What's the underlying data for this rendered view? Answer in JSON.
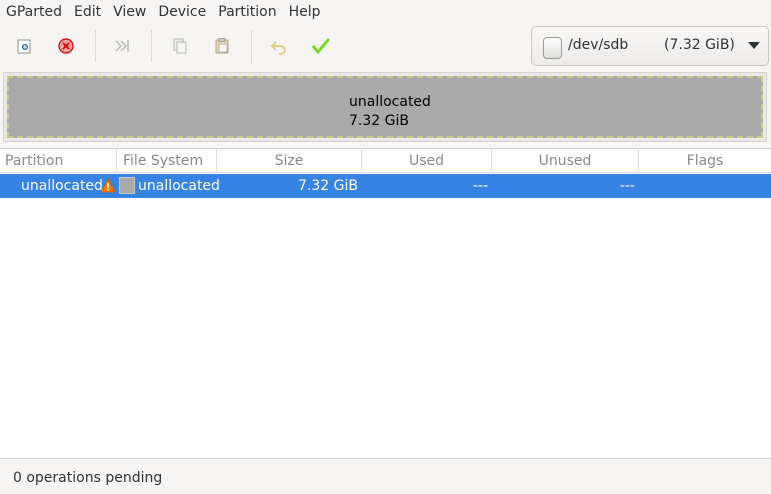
{
  "menu": [
    "GParted",
    "Edit",
    "View",
    "Device",
    "Partition",
    "Help"
  ],
  "toolbar": {
    "buttons": [
      {
        "name": "new-partition-icon"
      },
      {
        "name": "delete-partition-icon"
      },
      {
        "name": "resize-move-icon"
      },
      {
        "name": "copy-icon"
      },
      {
        "name": "paste-icon"
      },
      {
        "name": "undo-icon"
      },
      {
        "name": "apply-icon"
      }
    ]
  },
  "device": {
    "path": "/dev/sdb",
    "size": "(7.32 GiB)"
  },
  "diskmap": {
    "label": "unallocated",
    "size": "7.32 GiB"
  },
  "table": {
    "columns": [
      "Partition",
      "File System",
      "Size",
      "Used",
      "Unused",
      "Flags"
    ],
    "rows": [
      {
        "partition": "unallocated",
        "filesystem": "unallocated",
        "size": "7.32 GiB",
        "used": "---",
        "unused": "---",
        "flags": ""
      }
    ]
  },
  "status": "0 operations pending",
  "colors": {
    "selection": "#3584e4",
    "unallocated": "#a9a9a9",
    "warning": "#f57900",
    "apply": "#73d216"
  }
}
